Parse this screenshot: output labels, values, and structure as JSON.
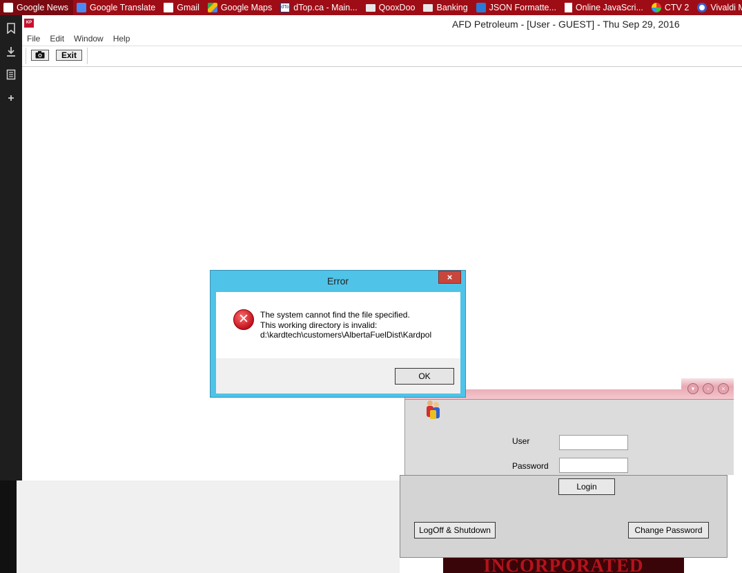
{
  "bookmarks": [
    {
      "label": "Google News",
      "icon": "news-icon"
    },
    {
      "label": "Google Translate",
      "icon": "translate-icon"
    },
    {
      "label": "Gmail",
      "icon": "gmail-icon"
    },
    {
      "label": "Google Maps",
      "icon": "maps-icon"
    },
    {
      "label": "dTop.ca - Main...",
      "icon": "dtop-icon",
      "icon_text": "dTop"
    },
    {
      "label": "QooxDoo",
      "icon": "folder-icon"
    },
    {
      "label": "Banking",
      "icon": "folder-icon"
    },
    {
      "label": "JSON Formatte...",
      "icon": "json-icon"
    },
    {
      "label": "Online JavaScri...",
      "icon": "document-icon"
    },
    {
      "label": "CTV 2",
      "icon": "ctv-icon"
    },
    {
      "label": "Vivaldi Mail :: L...",
      "icon": "vivaldi-icon"
    }
  ],
  "sidebar": {
    "icons": [
      "bookmark-icon",
      "download-icon",
      "notes-icon",
      "add-panel-icon"
    ]
  },
  "app": {
    "logo_text": "KP",
    "title": "AFD Petroleum - [User - GUEST] - Thu Sep 29, 2016",
    "menu": [
      "File",
      "Edit",
      "Window",
      "Help"
    ],
    "toolbar": {
      "camera_icon": "camera-icon",
      "exit_label": "Exit"
    }
  },
  "error_dialog": {
    "title": "Error",
    "close_label": "×",
    "icon": "error-icon",
    "message": [
      "The system cannot find the file specified.",
      "This working directory is invalid:",
      "d:\\kardtech\\customers\\AlbertaFuelDist\\Kardpol"
    ],
    "ok_label": "OK"
  },
  "login": {
    "user_label": "User",
    "password_label": "Password",
    "user_value": "",
    "password_value": "",
    "login_label": "Login",
    "logoff_label": "LogOff & Shutdown",
    "change_password_label": "Change Password",
    "banner_text": "INCORPORATED",
    "colors": {
      "titlebar": "#e9a8b2",
      "body": "#dcdcdc"
    }
  },
  "colors": {
    "bookmarks_bar": "#9e0d16",
    "sidebar": "#1e1e1e",
    "dialog_frame": "#4fc3e8",
    "dialog_close": "#c9463d"
  }
}
